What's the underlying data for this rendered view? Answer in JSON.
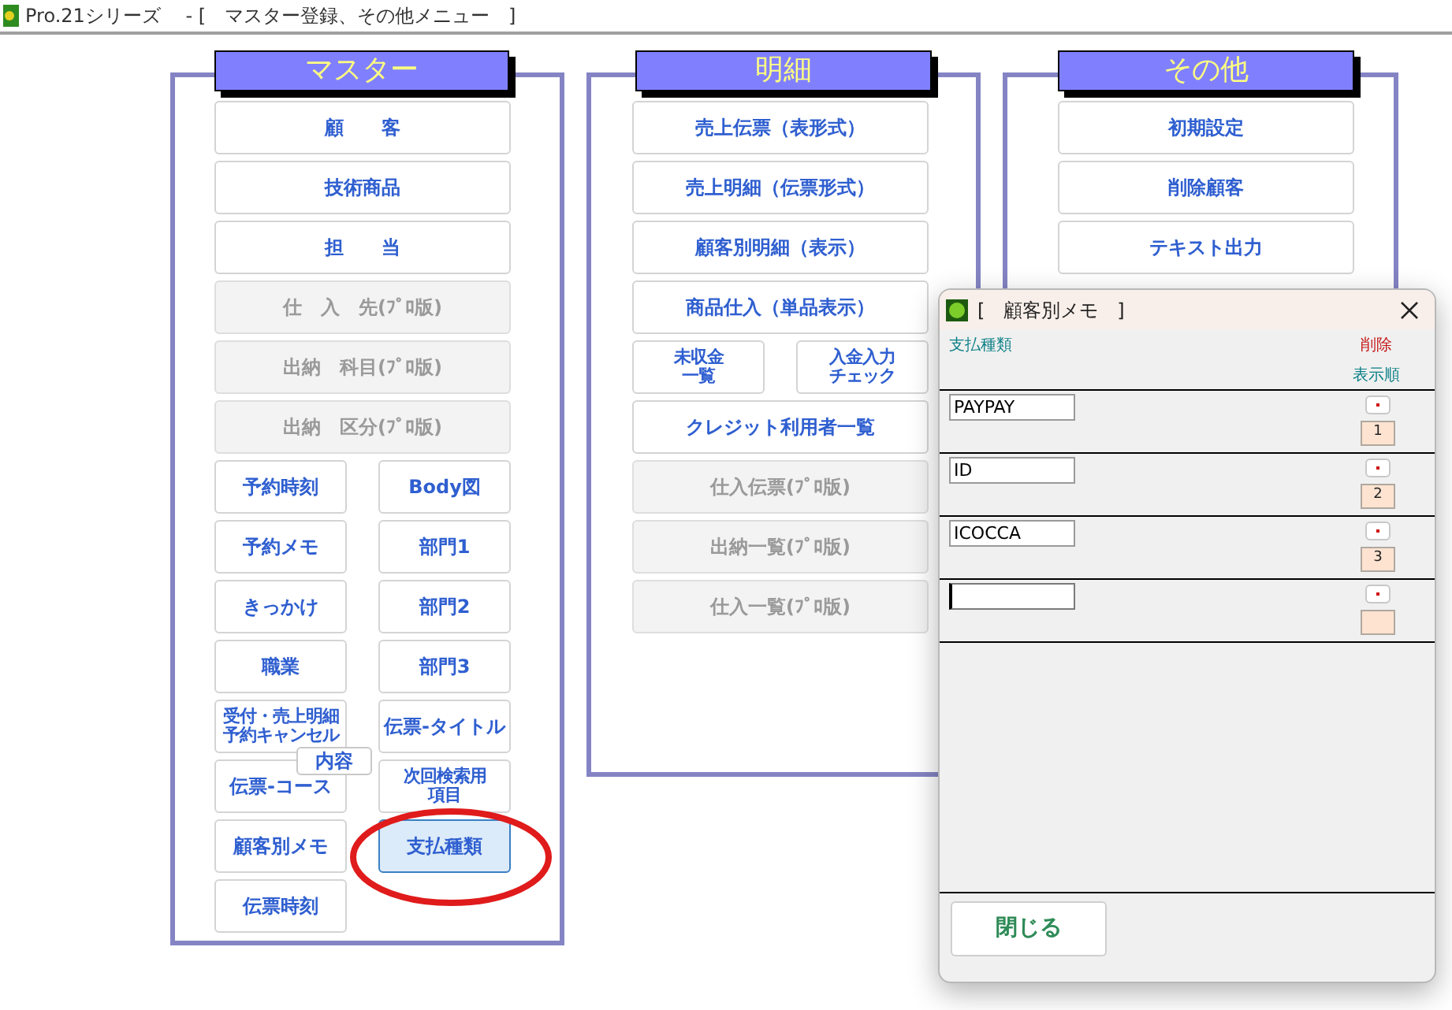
{
  "window": {
    "title": "Pro.21シリーズ　 - [　マスター登録、その他メニュー　]"
  },
  "panels": [
    {
      "title": "マスター",
      "buttons": [
        {
          "label": "顧　　客",
          "kind": "wide",
          "disabled": false,
          "selected": false
        },
        {
          "label": "技術商品",
          "kind": "wide",
          "disabled": false,
          "selected": false
        },
        {
          "label": "担　　当",
          "kind": "wide",
          "disabled": false,
          "selected": false
        },
        {
          "label": "仕　入　先(ﾌﾟﾛ版)",
          "kind": "wide",
          "disabled": true,
          "selected": false
        },
        {
          "label": "出納　科目(ﾌﾟﾛ版)",
          "kind": "wide",
          "disabled": true,
          "selected": false
        },
        {
          "label": "出納　区分(ﾌﾟﾛ版)",
          "kind": "wide",
          "disabled": true,
          "selected": false
        },
        {
          "label": "予約時刻",
          "kind": "half",
          "disabled": false,
          "selected": false
        },
        {
          "label": "Body図",
          "kind": "half",
          "disabled": false,
          "selected": false
        },
        {
          "label": "予約メモ",
          "kind": "half",
          "disabled": false,
          "selected": false
        },
        {
          "label": "部門1",
          "kind": "half",
          "disabled": false,
          "selected": false
        },
        {
          "label": "きっかけ",
          "kind": "half",
          "disabled": false,
          "selected": false
        },
        {
          "label": "部門2",
          "kind": "half",
          "disabled": false,
          "selected": false
        },
        {
          "label": "職業",
          "kind": "half",
          "disabled": false,
          "selected": false
        },
        {
          "label": "部門3",
          "kind": "half",
          "disabled": false,
          "selected": false
        },
        {
          "lines": [
            "受付・売上明細",
            "予約キャンセル"
          ],
          "kind": "half",
          "disabled": false,
          "selected": false
        },
        {
          "label": "伝票-タイトル",
          "kind": "half",
          "disabled": false,
          "selected": false
        },
        {
          "label": "伝票-コース",
          "kind": "half",
          "disabled": false,
          "selected": false
        },
        {
          "lines": [
            "次回検索用",
            "項目"
          ],
          "kind": "half",
          "disabled": false,
          "selected": false
        },
        {
          "label": "顧客別メモ",
          "kind": "half",
          "disabled": false,
          "selected": false
        },
        {
          "label": "支払種類",
          "kind": "half",
          "disabled": false,
          "selected": true
        },
        {
          "label": "伝票時刻",
          "kind": "half",
          "disabled": false,
          "selected": false
        }
      ],
      "overlay_label": "内容"
    },
    {
      "title": "明細",
      "buttons": [
        {
          "label": "売上伝票（表形式）",
          "kind": "wide",
          "disabled": false,
          "selected": false
        },
        {
          "label": "売上明細（伝票形式）",
          "kind": "wide",
          "disabled": false,
          "selected": false
        },
        {
          "label": "顧客別明細（表示）",
          "kind": "wide",
          "disabled": false,
          "selected": false
        },
        {
          "label": "商品仕入（単品表示）",
          "kind": "wide",
          "disabled": false,
          "selected": false
        },
        {
          "lines": [
            "未収金",
            "一覧"
          ],
          "kind": "half",
          "disabled": false,
          "selected": false
        },
        {
          "lines": [
            "入金入力",
            "チェック"
          ],
          "kind": "half",
          "disabled": false,
          "selected": false
        },
        {
          "label": "クレジット利用者一覧",
          "kind": "wide",
          "disabled": false,
          "selected": false
        },
        {
          "label": "仕入伝票(ﾌﾟﾛ版)",
          "kind": "wide",
          "disabled": true,
          "selected": false
        },
        {
          "label": "出納一覧(ﾌﾟﾛ版)",
          "kind": "wide",
          "disabled": true,
          "selected": false
        },
        {
          "label": "仕入一覧(ﾌﾟﾛ版)",
          "kind": "wide",
          "disabled": true,
          "selected": false
        }
      ]
    },
    {
      "title": "その他",
      "buttons": [
        {
          "label": "初期設定",
          "kind": "wide",
          "disabled": false,
          "selected": false
        },
        {
          "label": "削除顧客",
          "kind": "wide",
          "disabled": false,
          "selected": false
        },
        {
          "label": "テキスト出力",
          "kind": "wide",
          "disabled": false,
          "selected": false
        }
      ]
    }
  ],
  "dialog": {
    "title": "[　顧客別メモ　]",
    "column_name": "支払種類",
    "delete_label": "削除",
    "order_label": "表示順",
    "rows": [
      {
        "value": "PAYPAY",
        "order": "1",
        "focused": false
      },
      {
        "value": "ID",
        "order": "2",
        "focused": false
      },
      {
        "value": "ICOCCA",
        "order": "3",
        "focused": false
      },
      {
        "focused": true
      }
    ],
    "close_button": "閉じる"
  }
}
